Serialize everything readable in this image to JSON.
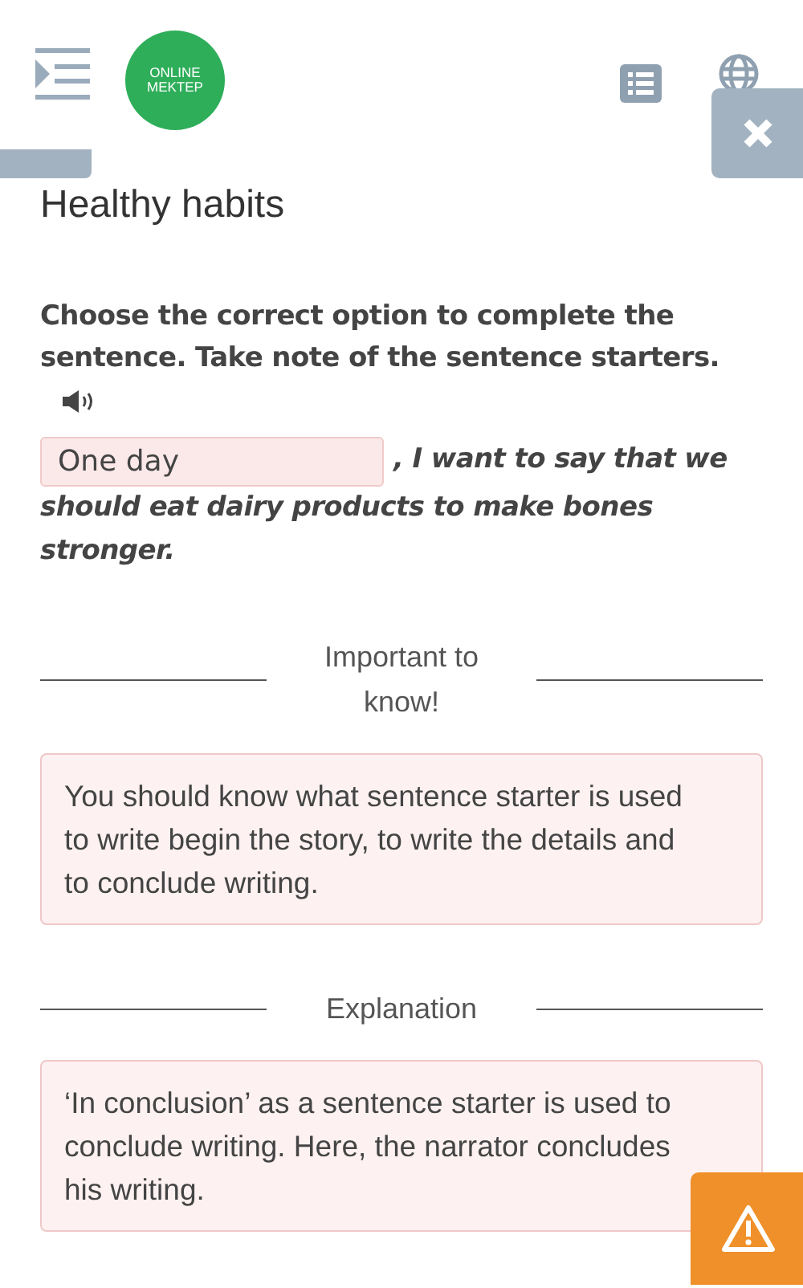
{
  "header": {
    "logo": [
      "ONLINE",
      "MEKTEP"
    ]
  },
  "title": "Healthy habits",
  "instruction": "Choose the correct option to complete the sentence. Take note of the sentence starters.",
  "gap_fill": {
    "value": "One day",
    "sentence": [
      ", I want to say that we",
      "should eat dairy products to make bones stronger."
    ]
  },
  "sections": [
    {
      "heading": "Important to know!",
      "text": "You should know what sentence starter is used to write begin the story, to write the details and to conclude writing."
    },
    {
      "heading": "Explanation",
      "text": "‘In conclusion’ as a sentence starter is used to conclude writing. Here, the narrator concludes his writing."
    }
  ]
}
